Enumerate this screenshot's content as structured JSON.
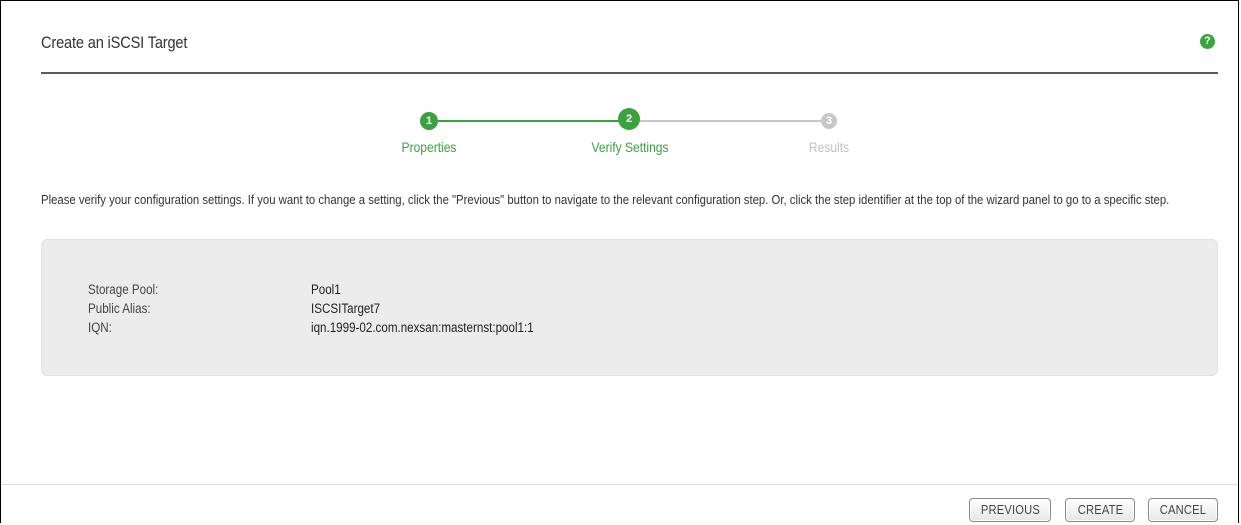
{
  "dialog": {
    "title": "Create an iSCSI Target",
    "help_icon": "help-icon",
    "help_glyph": "?"
  },
  "wizard": {
    "steps": [
      {
        "number": "1",
        "label": "Properties",
        "state": "completed"
      },
      {
        "number": "2",
        "label": "Verify Settings",
        "state": "current"
      },
      {
        "number": "3",
        "label": "Results",
        "state": "pending"
      }
    ]
  },
  "instructions": "Please verify your configuration settings. If you want to change a setting, click the \"Previous\" button to navigate to the relevant configuration step. Or, click the step identifier at the top of the wizard panel to go to a specific step.",
  "settings": [
    {
      "label": "Storage Pool:",
      "value": "Pool1"
    },
    {
      "label": "Public Alias:",
      "value": "ISCSITarget7"
    },
    {
      "label": "IQN:",
      "value": "iqn.1999-02.com.nexsan:masternst:pool1:1"
    }
  ],
  "buttons": {
    "previous": "PREVIOUS",
    "create": "CREATE",
    "cancel": "CANCEL"
  },
  "colors": {
    "accent_green": "#3ca241",
    "pending_gray": "#c8c8c8",
    "panel_bg": "#ececec"
  }
}
